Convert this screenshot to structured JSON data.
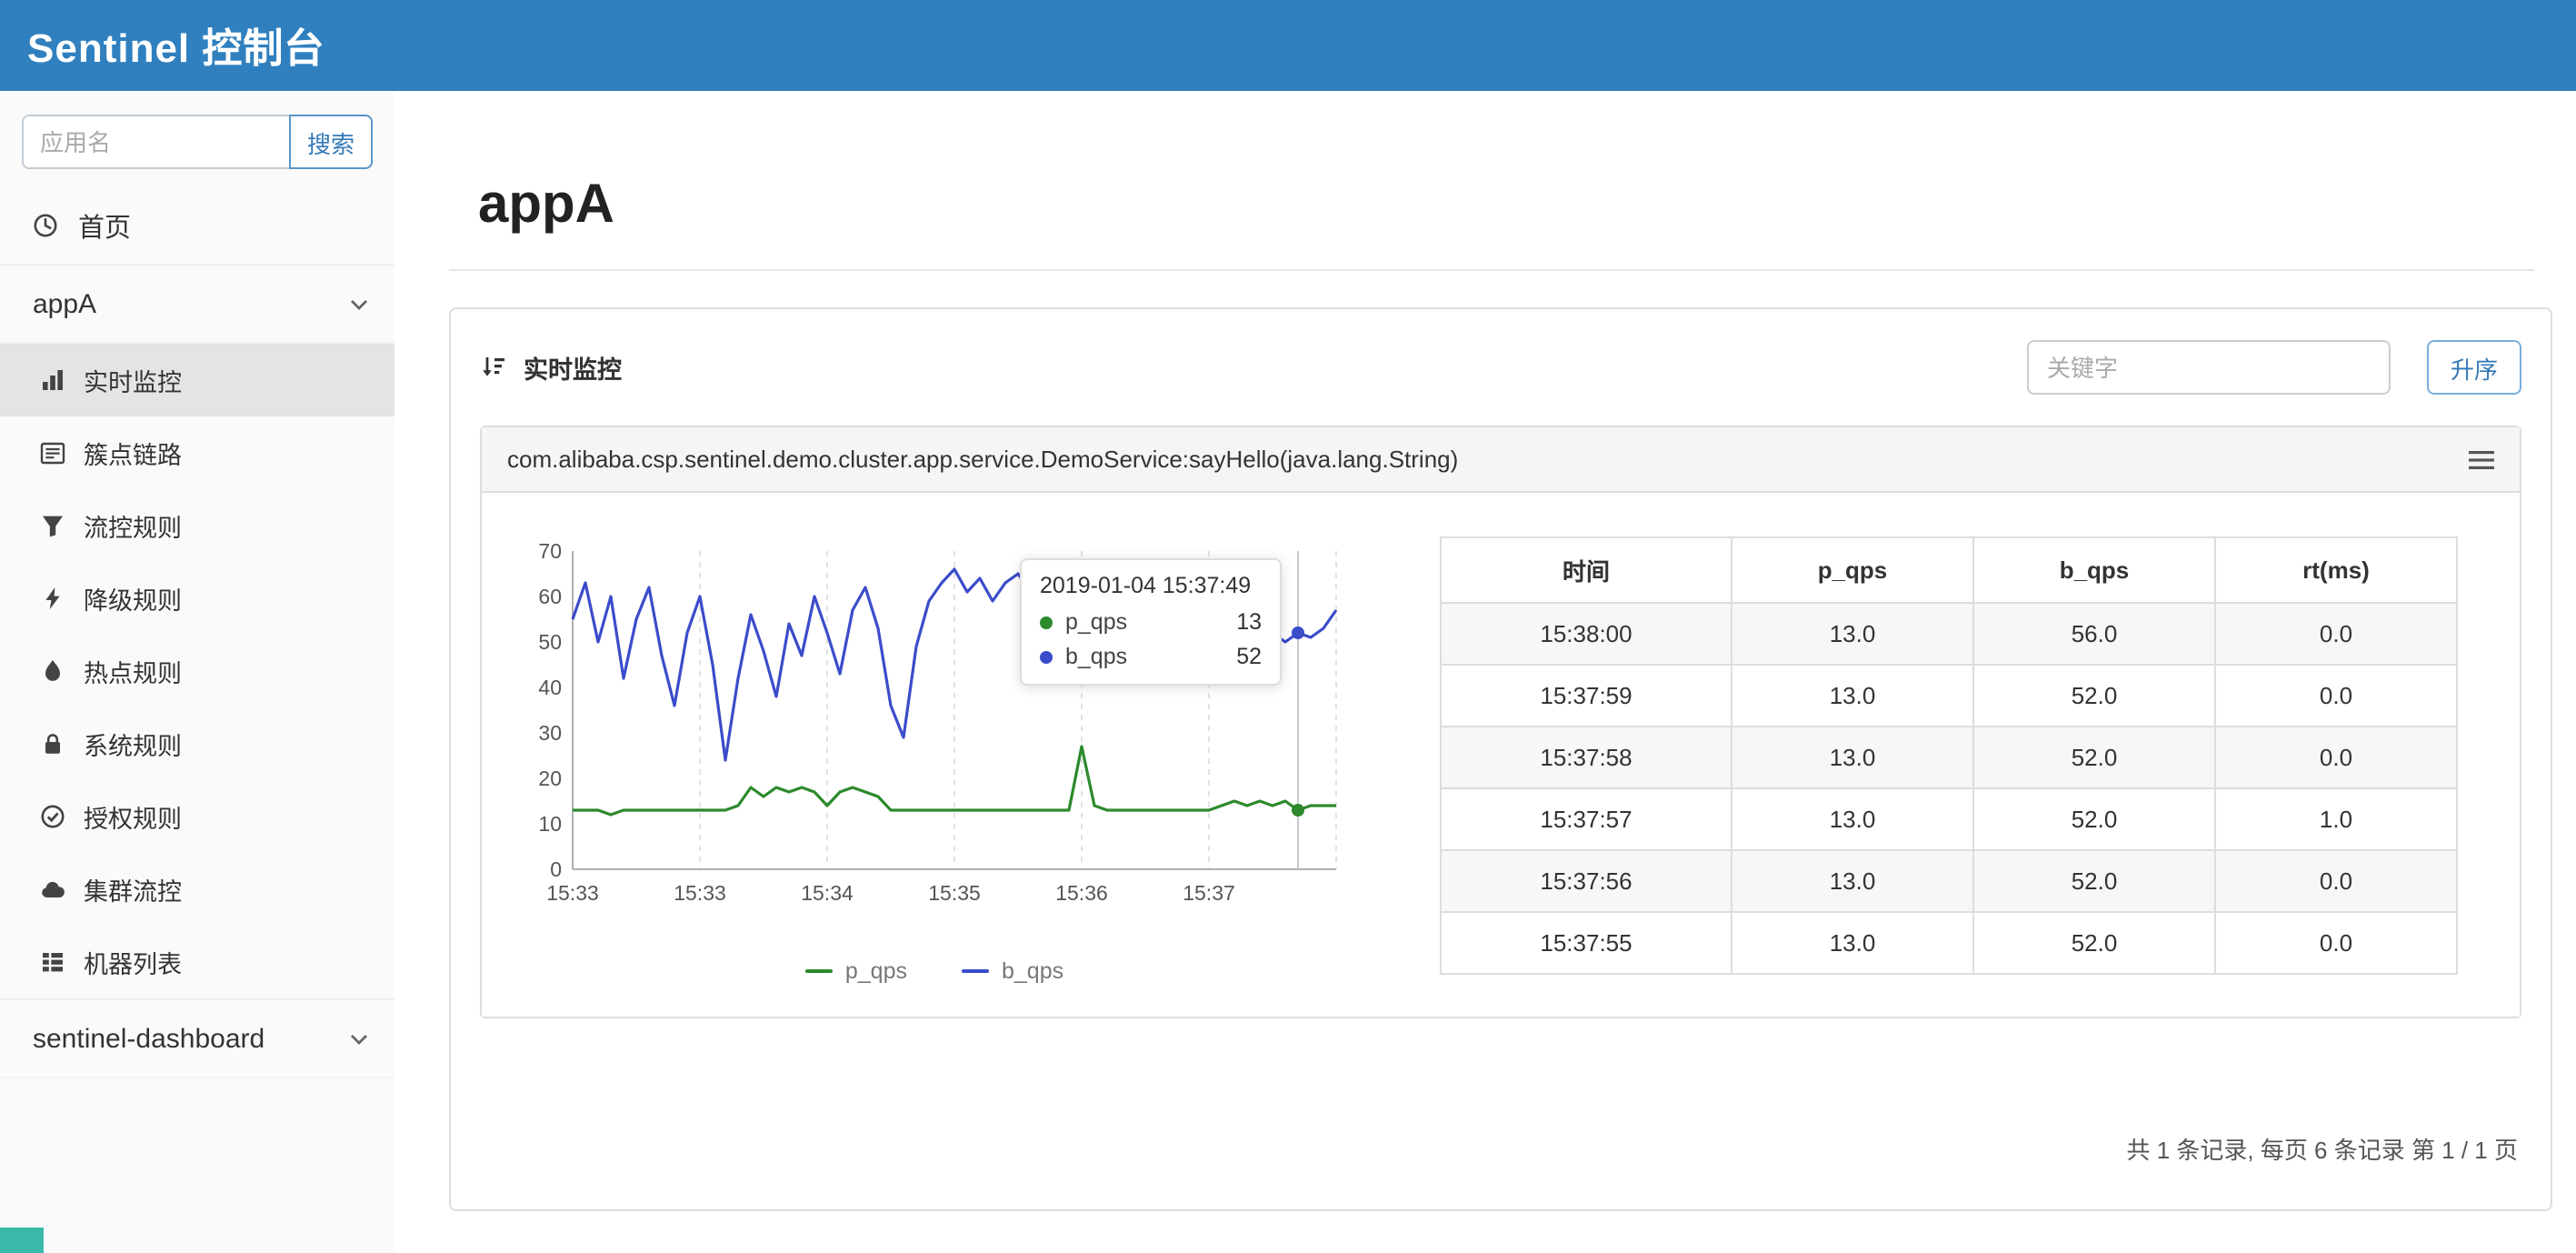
{
  "colors": {
    "navbar": "#3080bf",
    "accent": "#337ab7",
    "p_qps": "#2c8a2c",
    "b_qps": "#3b4cca"
  },
  "header": {
    "title": "Sentinel 控制台"
  },
  "sidebar": {
    "search": {
      "placeholder": "应用名",
      "button_label": "搜索"
    },
    "home": {
      "label": "首页"
    },
    "app_group": {
      "label": "appA",
      "items": [
        {
          "label": "实时监控",
          "active": true
        },
        {
          "label": "簇点链路",
          "active": false
        },
        {
          "label": "流控规则",
          "active": false
        },
        {
          "label": "降级规则",
          "active": false
        },
        {
          "label": "热点规则",
          "active": false
        },
        {
          "label": "系统规则",
          "active": false
        },
        {
          "label": "授权规则",
          "active": false
        },
        {
          "label": "集群流控",
          "active": false
        },
        {
          "label": "机器列表",
          "active": false
        }
      ]
    },
    "dashboard_group": {
      "label": "sentinel-dashboard"
    }
  },
  "main": {
    "page_title": "appA",
    "panel": {
      "title": "实时监控",
      "keyword_placeholder": "关键字",
      "sort_button_label": "升序"
    },
    "resource": {
      "name": "com.alibaba.csp.sentinel.demo.cluster.app.service.DemoService:sayHello(java.lang.String)"
    },
    "pagination": "共 1 条记录, 每页 6 条记录 第 1 / 1 页"
  },
  "table": {
    "headers": [
      "时间",
      "p_qps",
      "b_qps",
      "rt(ms)"
    ],
    "rows": [
      [
        "15:38:00",
        "13.0",
        "56.0",
        "0.0"
      ],
      [
        "15:37:59",
        "13.0",
        "52.0",
        "0.0"
      ],
      [
        "15:37:58",
        "13.0",
        "52.0",
        "0.0"
      ],
      [
        "15:37:57",
        "13.0",
        "52.0",
        "1.0"
      ],
      [
        "15:37:56",
        "13.0",
        "52.0",
        "0.0"
      ],
      [
        "15:37:55",
        "13.0",
        "52.0",
        "0.0"
      ]
    ]
  },
  "chart_data": {
    "type": "line",
    "title": "",
    "xlabel": "",
    "ylabel": "",
    "ylim": [
      0,
      70
    ],
    "y_ticks": [
      0,
      10,
      20,
      30,
      40,
      50,
      60,
      70
    ],
    "x_ticks": [
      "15:33",
      "15:33",
      "15:34",
      "15:35",
      "15:36",
      "15:37"
    ],
    "grid": "vertical-dashed",
    "legend_position": "bottom",
    "hover_index": 57,
    "series": [
      {
        "name": "p_qps",
        "color": "#2c8a2c",
        "values": [
          13,
          13,
          13,
          12,
          13,
          13,
          13,
          13,
          13,
          13,
          13,
          13,
          13,
          14,
          18,
          16,
          18,
          17,
          18,
          17,
          14,
          17,
          18,
          17,
          16,
          13,
          13,
          13,
          13,
          13,
          13,
          13,
          13,
          13,
          13,
          13,
          13,
          13,
          13,
          13,
          27,
          14,
          13,
          13,
          13,
          13,
          13,
          13,
          13,
          13,
          13,
          14,
          15,
          14,
          15,
          14,
          15,
          13,
          14,
          14,
          14
        ]
      },
      {
        "name": "b_qps",
        "color": "#3b4cca",
        "values": [
          55,
          63,
          50,
          60,
          42,
          55,
          62,
          47,
          36,
          52,
          60,
          45,
          24,
          42,
          56,
          48,
          38,
          54,
          47,
          60,
          52,
          43,
          57,
          62,
          53,
          36,
          29,
          49,
          59,
          63,
          66,
          61,
          64,
          59,
          63,
          65,
          61,
          56,
          63,
          66,
          64,
          61,
          65,
          63,
          66,
          64,
          62,
          65,
          63,
          64,
          66,
          63,
          53,
          50,
          54,
          52,
          50,
          52,
          51,
          53,
          57
        ]
      }
    ],
    "tooltip": {
      "time": "2019-01-04 15:37:49",
      "rows": [
        {
          "label": "p_qps",
          "value": 13
        },
        {
          "label": "b_qps",
          "value": 52
        }
      ]
    }
  }
}
